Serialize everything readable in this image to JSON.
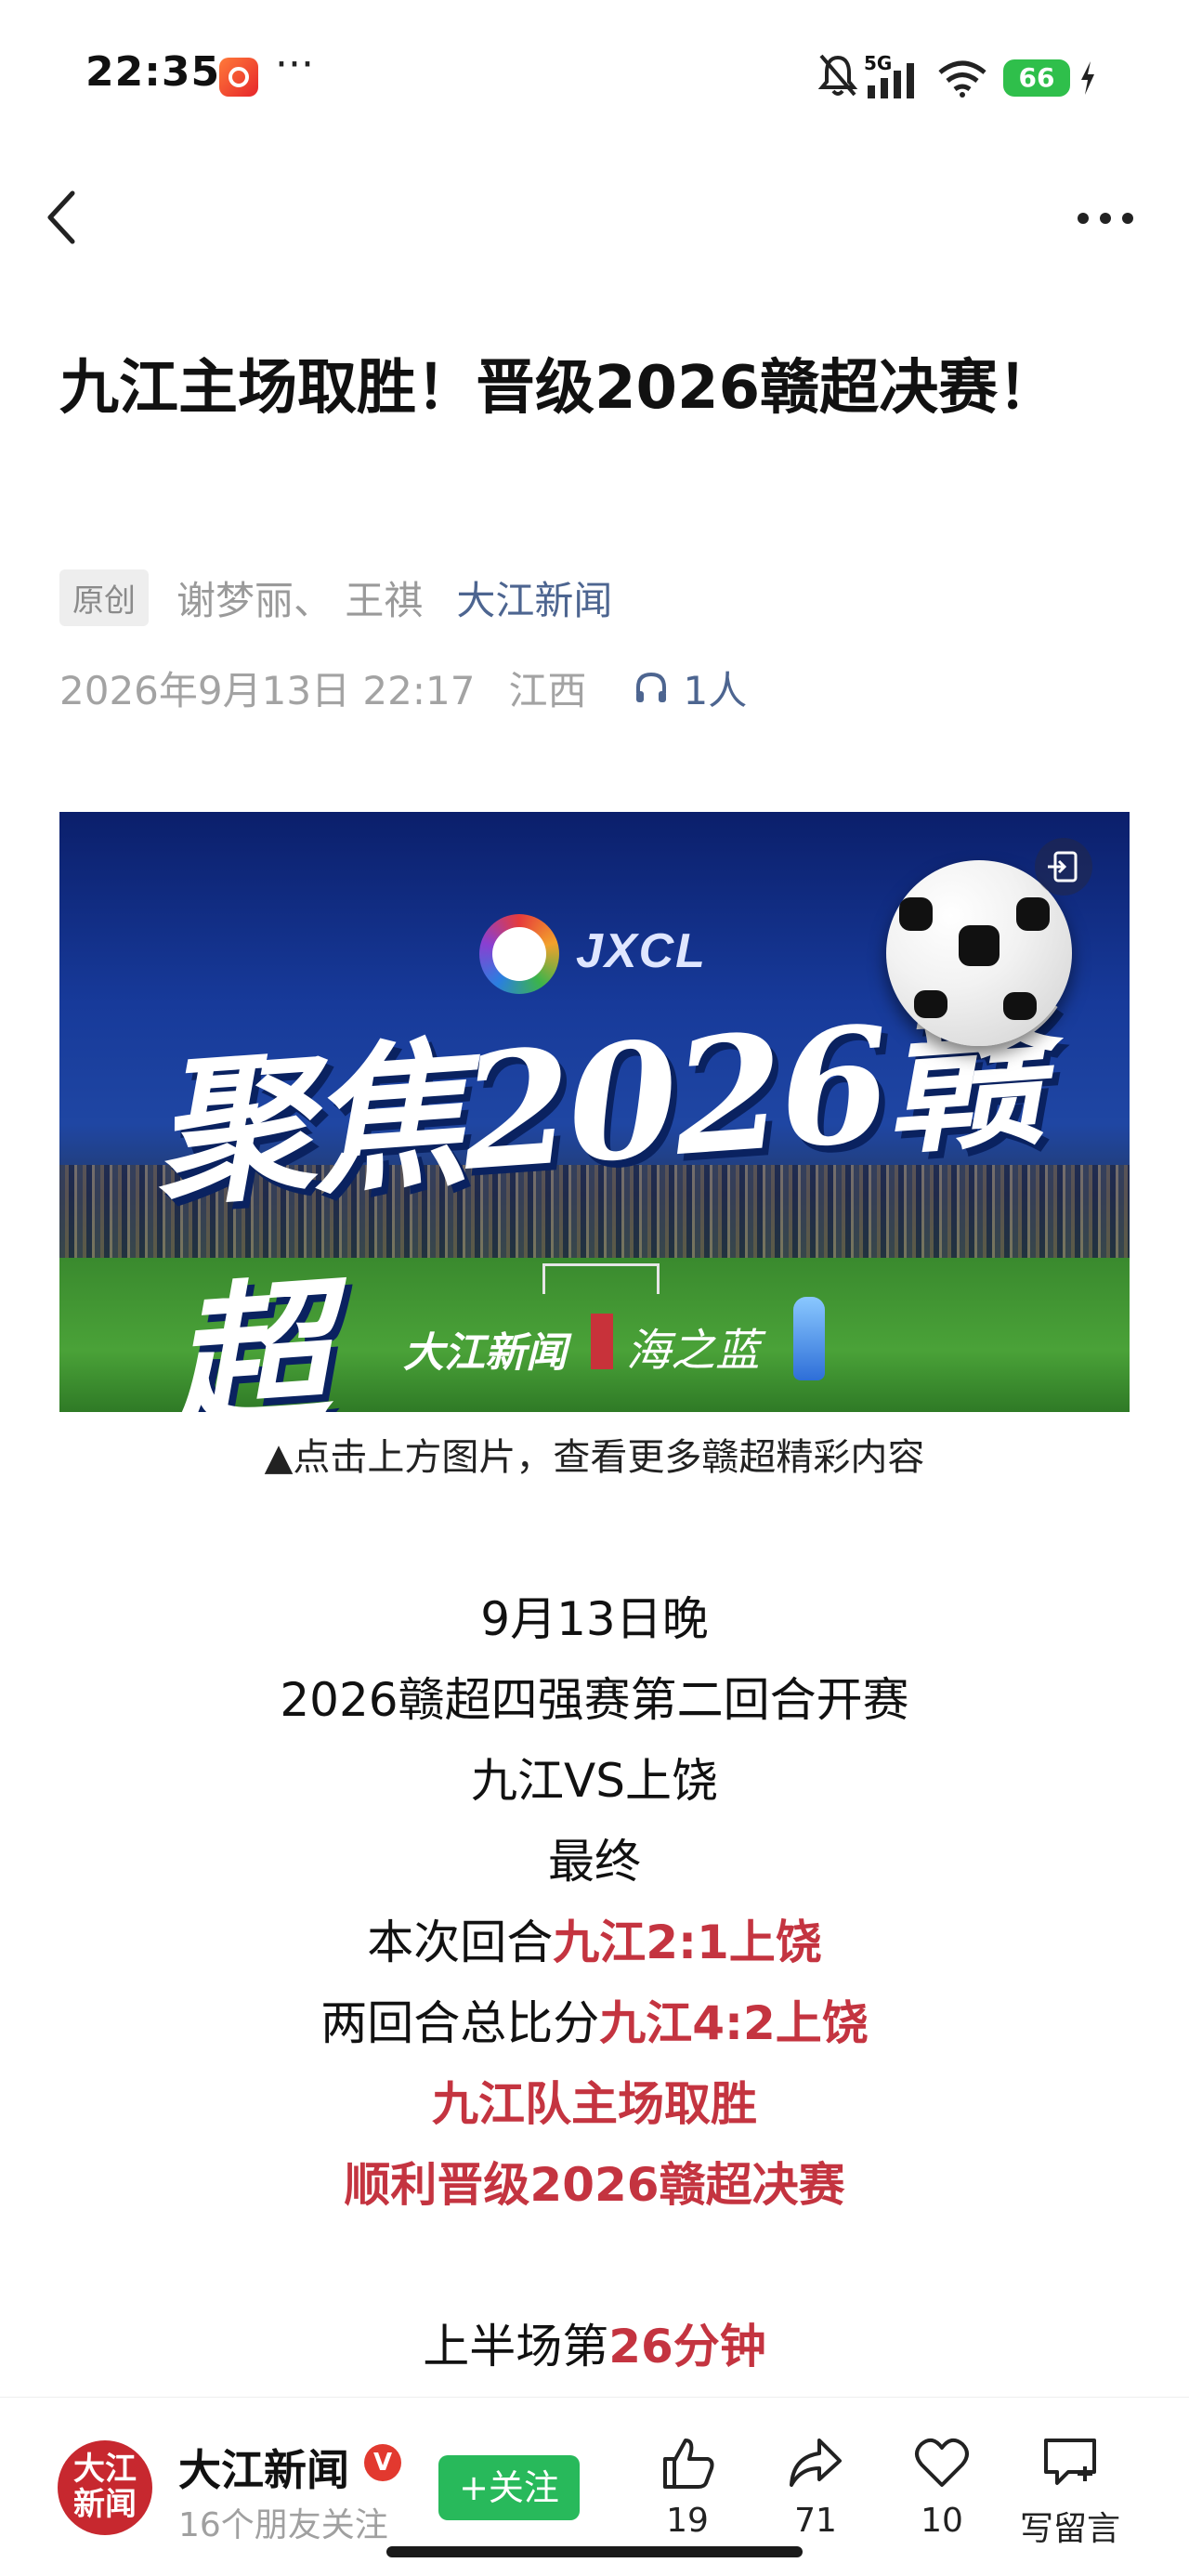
{
  "status_bar": {
    "time": "22:35",
    "more": "···",
    "network": "5G",
    "battery": "66"
  },
  "article": {
    "title": "九江主场取胜！晋级2026赣超决赛！",
    "badge": "原创",
    "authors": "谢梦丽、 王祺",
    "source": "大江新闻",
    "datetime": "2026年9月13日 22:17",
    "region": "江西",
    "listeners": "1人",
    "banner": {
      "logo_text": "JXCL",
      "headline": "聚焦2026赣超",
      "brand1": "大江新闻",
      "brand2": "海之蓝"
    },
    "image_caption": "▲点击上方图片，查看更多赣超精彩内容",
    "body": {
      "l1": "9月13日晚",
      "l2": "2026赣超四强赛第二回合开赛",
      "l3": "九江VS上饶",
      "l4": "最终",
      "l5_prefix": "本次回合",
      "l5_red": "九江2:1上饶",
      "l6_prefix": "两回合总比分",
      "l6_red": "九江4:2上饶",
      "l7_red": "九江队主场取胜",
      "l8_red": "顺利晋级2026赣超决赛",
      "l9_prefix": "上半场第",
      "l9_red": "26分钟"
    }
  },
  "bottom_bar": {
    "avatar_text_1": "大江",
    "avatar_text_2": "新闻",
    "publisher": "大江新闻",
    "verified": "V",
    "friends_following": "16个朋友关注",
    "follow_button": "+关注",
    "likes": "19",
    "shares": "71",
    "favorites": "10",
    "comment_label": "写留言"
  },
  "colors": {
    "accent_red": "#c43440",
    "link_blue": "#4d6590",
    "follow_green": "#28b95b"
  }
}
